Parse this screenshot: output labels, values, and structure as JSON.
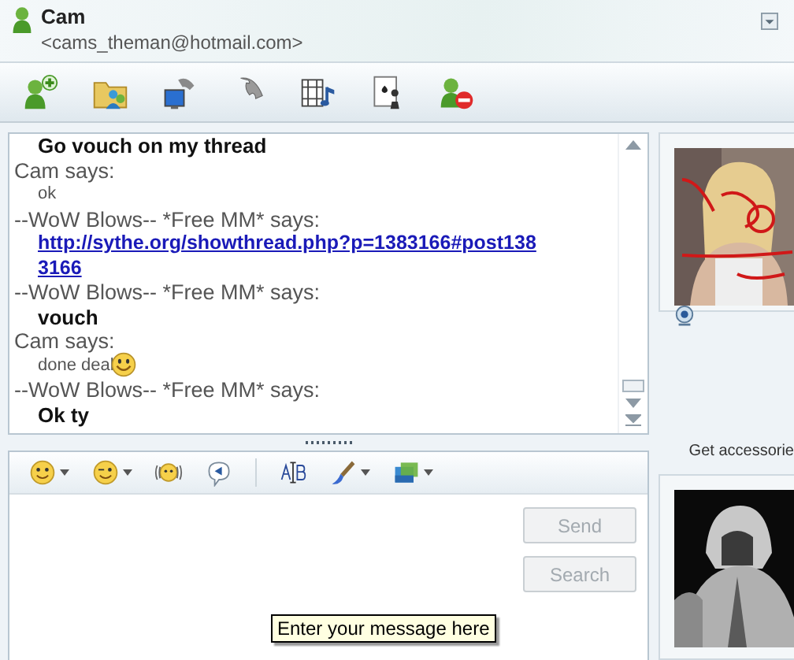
{
  "contact": {
    "name": "Cam",
    "email": "<cams_theman@hotmail.com>"
  },
  "conversation": [
    {
      "kind": "bold",
      "text": "Go vouch on my thread"
    },
    {
      "kind": "sender",
      "text": "Cam says:"
    },
    {
      "kind": "plain",
      "text": "ok"
    },
    {
      "kind": "sender",
      "text": "--WoW Blows-- *Free MM* says:"
    },
    {
      "kind": "link",
      "text": "http://sythe.org/showthread.php?p=1383166#post1383166"
    },
    {
      "kind": "sender",
      "text": "--WoW Blows-- *Free MM* says:"
    },
    {
      "kind": "bold",
      "text": "vouch"
    },
    {
      "kind": "sender",
      "text": "Cam says:"
    },
    {
      "kind": "plain",
      "text": "done deal",
      "emoticon": true
    },
    {
      "kind": "sender",
      "text": "--WoW Blows-- *Free MM* says:"
    },
    {
      "kind": "bold",
      "text": "Ok ty"
    }
  ],
  "compose": {
    "buttons": [
      {
        "label": "Send",
        "disabled": true
      },
      {
        "label": "Search",
        "disabled": true
      }
    ],
    "tooltip": "Enter your message here"
  },
  "side_panel": {
    "accessories_label": "Get accessorie"
  }
}
